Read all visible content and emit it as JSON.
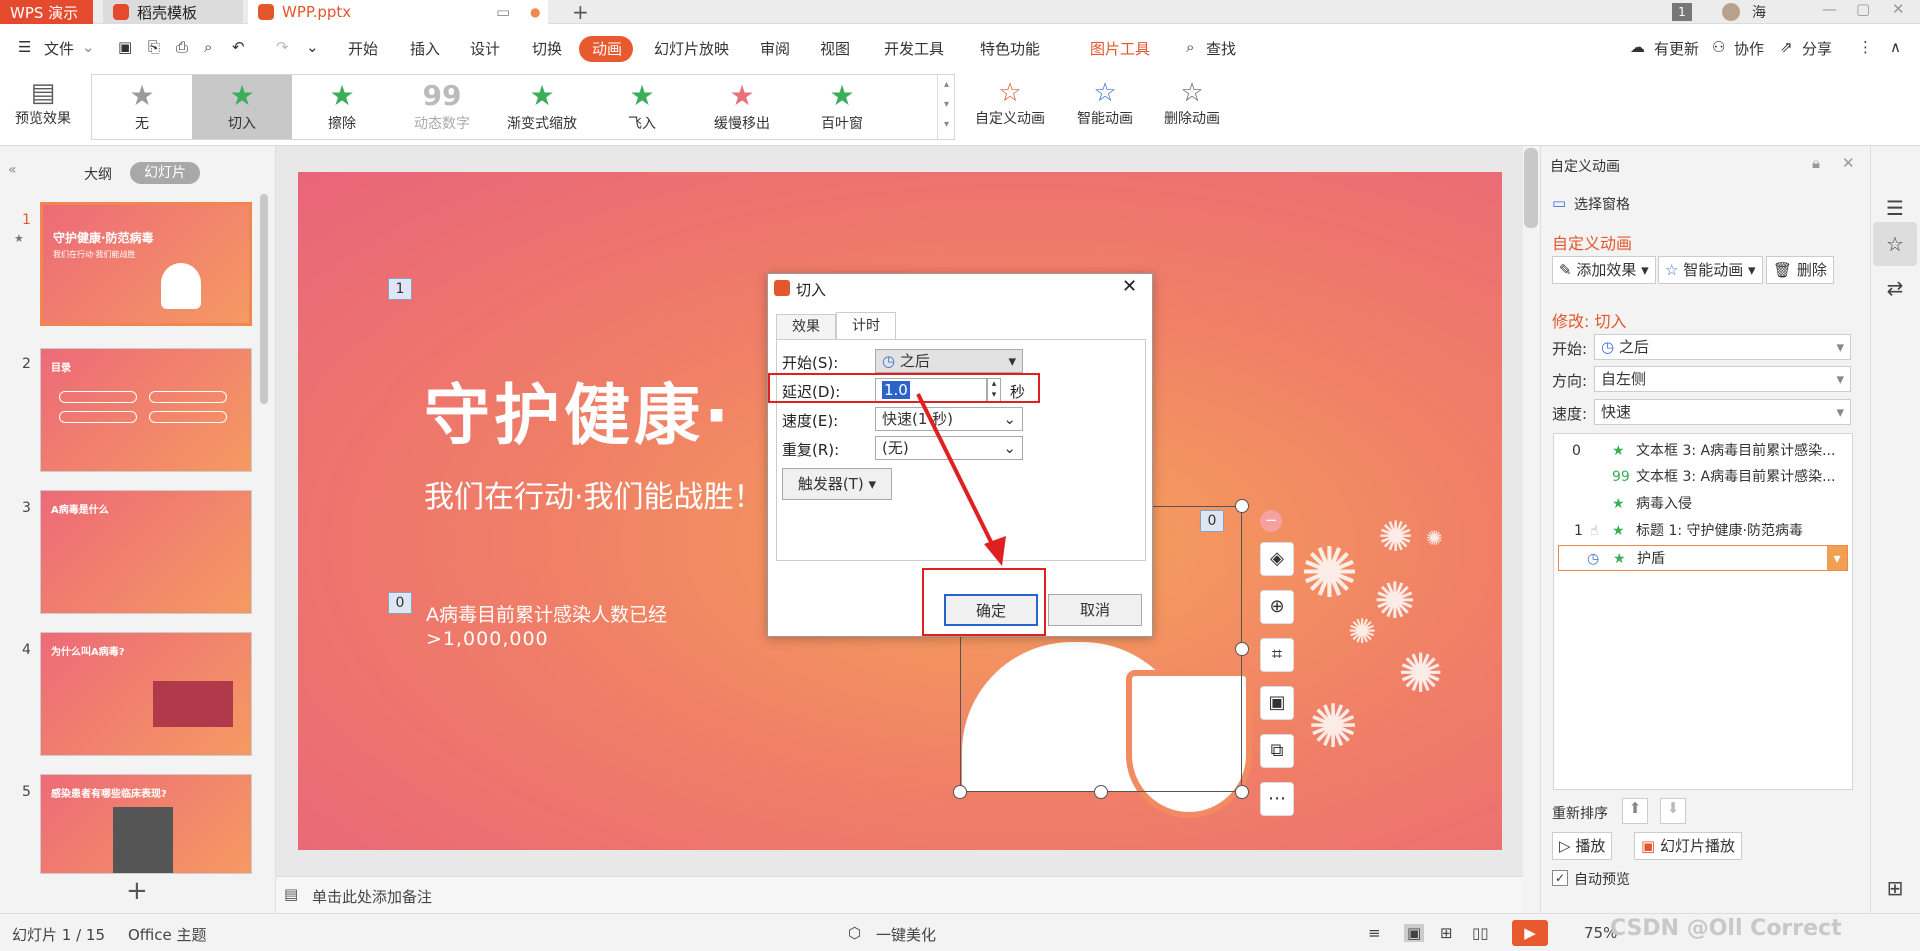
{
  "titlebar": {
    "wps_tab": "WPS 演示",
    "template_tab": "稻壳模板",
    "file_tab": "WPP.pptx",
    "page_badge": "1",
    "user": "海"
  },
  "menubar": {
    "file": "文件",
    "items": [
      "开始",
      "插入",
      "设计",
      "切换",
      "动画",
      "幻灯片放映",
      "审阅",
      "视图",
      "开发工具",
      "特色功能"
    ],
    "picture_tools": "图片工具",
    "search": "查找",
    "update": "有更新",
    "collab": "协作",
    "share": "分享"
  },
  "ribbon": {
    "preview": "预览效果",
    "effects": [
      "无",
      "切入",
      "擦除",
      "动态数字",
      "渐变式缩放",
      "飞入",
      "缓慢移出",
      "百叶窗"
    ],
    "custom_anim": "自定义动画",
    "smart_anim": "智能动画",
    "delete_anim": "删除动画"
  },
  "leftpanel": {
    "outline_tab": "大纲",
    "slides_tab": "幻灯片",
    "thumbs": [
      {
        "num": "1",
        "title": "守护健康·防范病毒",
        "sub": "我们在行动·我们能战胜"
      },
      {
        "num": "2",
        "title": "目录"
      },
      {
        "num": "3",
        "title": "A病毒是什么"
      },
      {
        "num": "4",
        "title": "为什么叫A病毒?"
      },
      {
        "num": "5",
        "title": "感染患者有哪些临床表现?"
      }
    ]
  },
  "slide": {
    "title": "守护健康·",
    "subtitle": "我们在行动·我们能战胜！",
    "info_line1": "A病毒目前累计感染人数已经",
    "info_line2": ">1,000,000",
    "tag1": "1",
    "tag0a": "0",
    "tag0b": "0"
  },
  "dialog": {
    "title": "切入",
    "tab_effect": "效果",
    "tab_timing": "计时",
    "start_label": "开始(S):",
    "start_value": "之后",
    "delay_label": "延迟(D):",
    "delay_value": "1.0",
    "delay_unit": "秒",
    "speed_label": "速度(E):",
    "speed_value": "快速(1 秒)",
    "repeat_label": "重复(R):",
    "repeat_value": "(无)",
    "trigger": "触发器(T)",
    "ok": "确定",
    "cancel": "取消"
  },
  "rightpanel": {
    "header": "自定义动画",
    "select_pane": "选择窗格",
    "section_title": "自定义动画",
    "add_effect": "添加效果",
    "smart_anim": "智能动画",
    "delete": "删除",
    "modify": "修改: 切入",
    "start_label": "开始:",
    "start_value": "之后",
    "direction_label": "方向:",
    "direction_value": "自左侧",
    "speed_label": "速度:",
    "speed_value": "快速",
    "list": [
      {
        "num": "0",
        "text": "文本框 3: A病毒目前累计感染..."
      },
      {
        "num": "",
        "text": "文本框 3: A病毒目前累计感染..."
      },
      {
        "num": "",
        "text": "病毒入侵"
      },
      {
        "num": "1",
        "text": "标题 1: 守护健康·防范病毒"
      },
      {
        "num": "",
        "text": "护盾"
      }
    ],
    "reorder": "重新排序",
    "play": "播放",
    "slideshow": "幻灯片播放",
    "auto_preview": "自动预览"
  },
  "notes": {
    "placeholder": "单击此处添加备注"
  },
  "statusbar": {
    "slide_count": "幻灯片 1 / 15",
    "theme": "Office 主题",
    "beautify": "一键美化",
    "zoom": "75%",
    "watermark": "CSDN @Oll Correct"
  },
  "colors": {
    "accent": "#e9592f",
    "slide_gradient_a": "#e9647a",
    "slide_gradient_b": "#f6a35c",
    "annotation": "#e02020"
  }
}
